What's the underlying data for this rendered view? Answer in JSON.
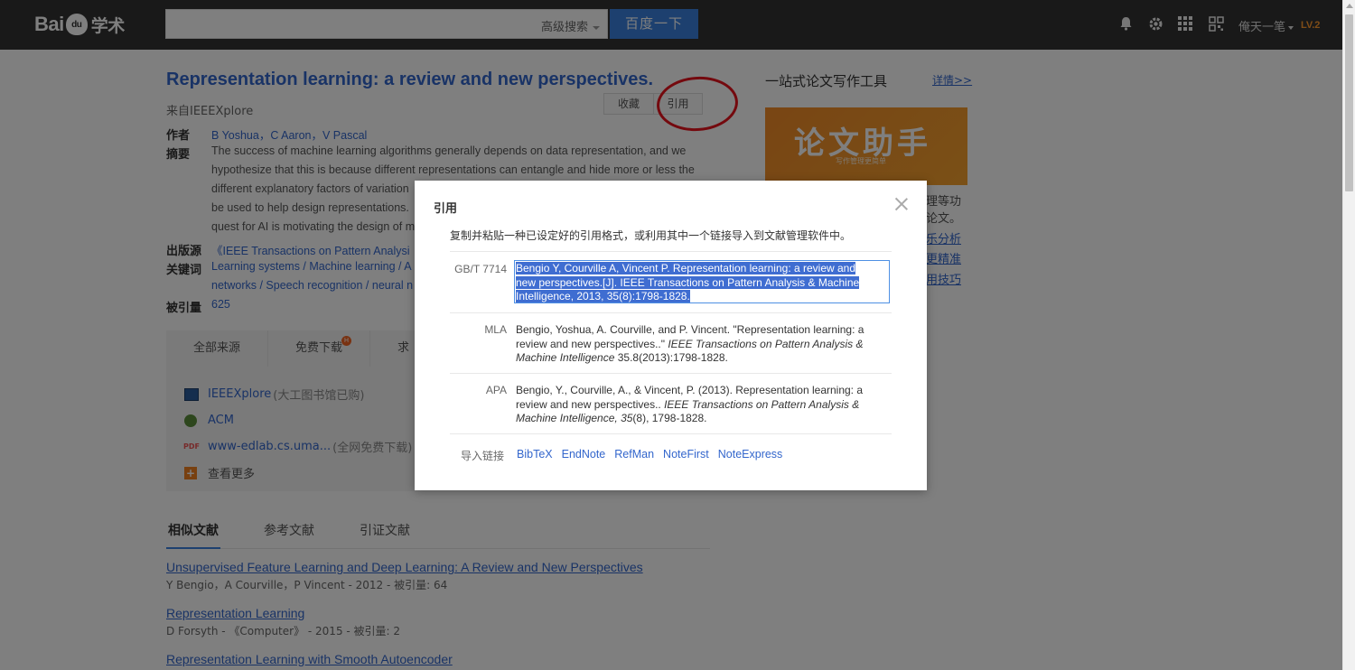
{
  "header": {
    "logo_text": "Bai",
    "logo_paw": "du",
    "logo_cn": "学术",
    "search_value": "",
    "advanced_search": "高级搜索",
    "search_button": "百度一下",
    "username": "俺天一笔",
    "level": "LV.2"
  },
  "paper": {
    "title": "Representation learning: a review and new perspectives.",
    "source": "来自IEEEXplore",
    "favorite_label": "收藏",
    "cite_label": "引用",
    "authors_label": "作者",
    "authors": "B Yoshua，C Aaron，V Pascal",
    "abstract_label": "摘要",
    "abstract_lines": [
      "The success of machine learning algorithms generally depends on data representation, and we",
      "hypothesize that this is because different representations can entangle and hide more or less the",
      "different explanatory factors of variation",
      "be used to help design representations.",
      "quest for AI is motivating the design of m"
    ],
    "publisher_label": "出版源",
    "publisher": "《IEEE Transactions on Pattern Analysi",
    "keywords_label": "关键词",
    "keywords_line1": "Learning systems / Machine learning / A",
    "keywords_line2": "networks / Speech recognition / neural n",
    "citations_label": "被引量",
    "citations": "625"
  },
  "sources": {
    "tabs": [
      "全部来源",
      "免费下载",
      "求"
    ],
    "hot_badge": "H",
    "items": [
      {
        "name": "IEEEXplore",
        "note": "(大工图书馆已购)"
      },
      {
        "name": "ACM",
        "note": ""
      },
      {
        "name": "www-edlab.cs.uma...",
        "note": " (全网免费下载)"
      }
    ],
    "pdf_tag": "PDF",
    "more": "查看更多"
  },
  "similar": {
    "tabs": [
      "相似文献",
      "参考文献",
      "引证文献"
    ],
    "items": [
      {
        "title": "Unsupervised Feature Learning and Deep Learning: A Review and New Perspectives",
        "meta": "Y Bengio，A Courville，P Vincent - 2012 - 被引量: 64"
      },
      {
        "title": "Representation Learning",
        "meta": "D Forsyth - 《Computer》 - 2015 - 被引量: 2"
      },
      {
        "title": "Representation Learning with Smooth Autoencoder",
        "meta": ""
      }
    ]
  },
  "sidebar": {
    "title": "一站式论文写作工具",
    "more_link": "详情>>",
    "banner_big": "论文助手",
    "banner_small": "写作管理更简单",
    "fragments": [
      "理等功",
      "论文。"
    ],
    "links": [
      "乐分析",
      "更精准",
      "用技巧"
    ]
  },
  "modal": {
    "title": "引用",
    "description": "复制并粘贴一种已设定好的引用格式，或利用其中一个链接导入到文献管理软件中。",
    "gbt_label": "GB/T 7714",
    "gbt_lines": [
      "Bengio Y, Courville A, Vincent P. Representation learning: a review and",
      "new perspectives.[J]. IEEE Transactions on Pattern Analysis & Machine",
      "Intelligence, 2013, 35(8):1798-1828."
    ],
    "mla_label": "MLA",
    "mla_plain": "Bengio, Yoshua, A. Courville, and P. Vincent. \"Representation learning: a review and new perspectives..\" ",
    "mla_italic": "IEEE Transactions on Pattern Analysis & Machine Intelligence",
    "mla_tail": " 35.8(2013):1798-1828.",
    "apa_label": "APA",
    "apa_plain": "Bengio, Y., Courville, A., & Vincent, P. (2013). Representation learning: a review and new perspectives.. ",
    "apa_italic": "IEEE Transactions on Pattern Analysis & Machine Intelligence, 35",
    "apa_tail": "(8), 1798-1828.",
    "export_label": "导入链接",
    "export_links": [
      "BibTeX",
      "EndNote",
      "RefMan",
      "NoteFirst",
      "NoteExpress"
    ]
  }
}
